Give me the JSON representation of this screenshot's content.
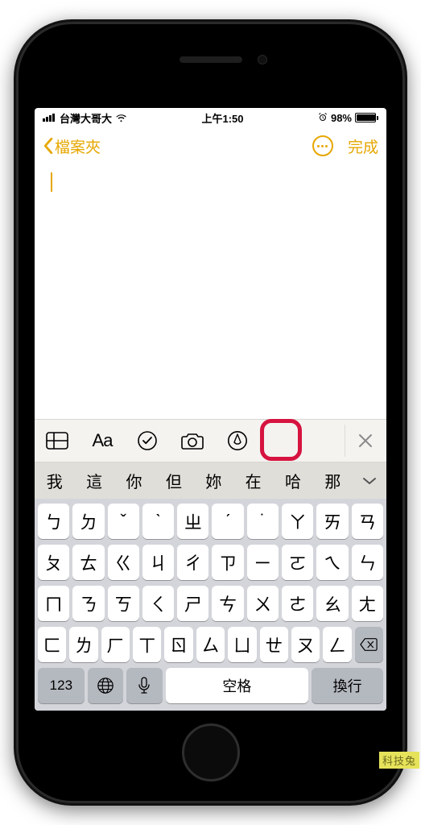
{
  "status": {
    "carrier": "台灣大哥大",
    "time": "上午1:50",
    "battery_pct": "98%"
  },
  "nav": {
    "back_label": "檔案夾",
    "done_label": "完成"
  },
  "note": {
    "content": ""
  },
  "toolbar": {
    "aa_label": "Aa"
  },
  "suggestions": [
    "我",
    "這",
    "你",
    "但",
    "妳",
    "在",
    "哈",
    "那"
  ],
  "keyboard": {
    "row1": [
      "ㄅ",
      "ㄉ",
      "ˇ",
      "ˋ",
      "ㄓ",
      "ˊ",
      "˙",
      "ㄚ",
      "ㄞ",
      "ㄢ"
    ],
    "row2": [
      "ㄆ",
      "ㄊ",
      "ㄍ",
      "ㄐ",
      "ㄔ",
      "ㄗ",
      "ㄧ",
      "ㄛ",
      "ㄟ",
      "ㄣ"
    ],
    "row3": [
      "ㄇ",
      "ㄋ",
      "ㄎ",
      "ㄑ",
      "ㄕ",
      "ㄘ",
      "ㄨ",
      "ㄜ",
      "ㄠ",
      "ㄤ"
    ],
    "row4": [
      "ㄈ",
      "ㄌ",
      "ㄏ",
      "ㄒ",
      "ㄖ",
      "ㄙ",
      "ㄩ",
      "ㄝ",
      "ㄡ",
      "ㄥ"
    ],
    "numbers": "123",
    "space": "空格",
    "enter": "換行"
  },
  "watermark": "科技兔"
}
